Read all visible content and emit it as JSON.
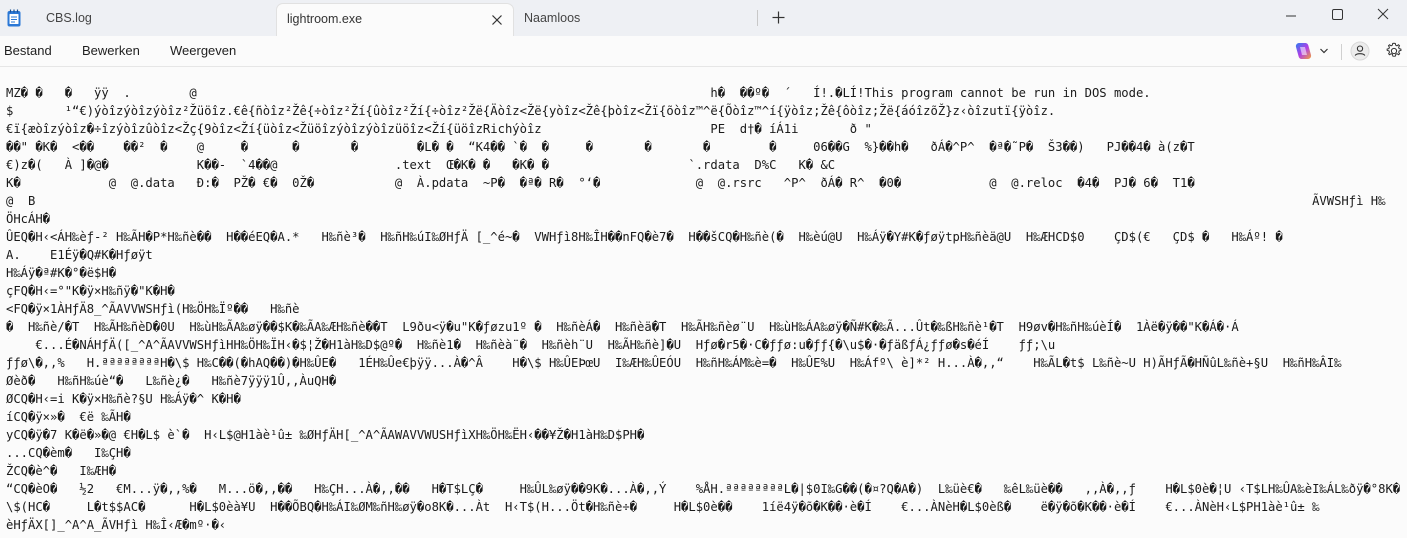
{
  "tabs": [
    {
      "label": "CBS.log"
    },
    {
      "label": "lightroom.exe"
    },
    {
      "label": "Naamloos"
    }
  ],
  "menu": [
    "Bestand",
    "Bewerken",
    "Weergeven"
  ],
  "icons": {
    "app": "notepad-icon",
    "close": "close-icon",
    "new_tab": "plus-icon",
    "minimize": "minimize-icon",
    "maximize": "maximize-icon",
    "window_close": "close-icon",
    "copilot": "copilot-icon",
    "account": "profile-icon",
    "settings": "gear-icon"
  },
  "colors": {
    "tab_bar": "#eef0f4",
    "editor_bg": "#fbfbfb",
    "text": "#1a1a1a"
  },
  "content": [
    "MZ� �   �   ÿÿ  .        @                                                                      h�  ��º�  ´   Í!.�LÍ!This program cannot be run in DOS mode.",
    "$       ¹“€)ýòîzýòîzýòîz²Žüöîz.€ê{ñòîz²Žê{÷òîz²Ží{ûòîz²Ží{÷òîz²Žë{Äòîz<Žë{yòîz<Žê{þòîz<Žï{õòîz™^ë{Õòîz™^í{ÿòîz;Žê{ôòîz;Žë{áóîzõŽ}z‹òîzutï{ÿòîz.",
    "€ï{æòîzýòîz�÷îzýòîzûòîz<Žç{9òîz<Ží{üòîz<Žüöîzýòîzýòîzüöîz<Ží{üöîzRichýòîz                       PE  d†� íÁ1i       ð \"",
    "��\" �K�  <��    ��²  �    @     �      �       �        �L� �  “K4�� `�  �     �       �       �        �     06��G  %}��h�   ðÁ�^P^  �ª�˜P�  Š3��)   PJ��4� à(z�T",
    "€)z�(   À ]�@�            K��-  `4��@                .text  Œ�K� �   �K� �                   `.rdata  D%C   K� &C",
    "K�            @  @.data   Ð:�  PŽ� €�  0Ž�           @  À.pdata  ~P�  �ª� R�  °‘�             @  @.rsrc   ^P^  ðÁ� R^  �0�            @  @.reloc  �4�  PJ� 6�  T1�",
    "@  B                                                                                                                                                                              ÃVWSHƒì H‰",
    "ÖHcÁH�",
    "ÛEQ�H‹<ÁH‰èƒ-² H‰ÃH�P*H‰ñè��  H��éEQ�A.*   H‰ñè³�  H‰ñH‰úI‰ØHƒÄ [_^é~�  VWHƒì8H‰ÎH��nFQ�è7�  H��šCQ�H‰ñè(�  H‰èú@U  H‰Áÿ�Y#K�ƒøÿtpH‰ñèä@U  H‰ÆHCD$0    ÇD$(€   ÇD$ �   H‰Áº! �",
    "A.    E1Éÿ�Q#K�Hƒøÿt",
    "H‰Áÿ�ª#K�°�ë$H�",
    "çFQ�H‹=°\"K�ÿ×H‰ñÿ�\"K�H�",
    "<FQ�ÿ×1ÀHƒÄ8_^ÃAVVWSHƒì(H‰ÖH‰Ïº��   H‰ñè",
    "�  H‰ñè/�T  H‰ÃH‰ñèD�0U  H‰ùH‰ÃA‰øÿ��$K�‰ÃA‰ÆH‰ñè��T  L9ðu<ÿ�u\"K�ƒøzu1º �  H‰ñèÁ�  H‰ñèä�T  H‰ÃH‰ñèø¨U  H‰ùH‰ÁA‰øÿ�Ñ#K�‰Ã...Ût�‰ßH‰ñè¹�T  H9øv�H‰ñH‰úèÍ�  1Àë�ÿ��\"K�Á�·Á",
    "    €...É�NÁHƒÄ([_^A^ÃAVVWSHƒìHH‰ÖH‰ÏH‹�$¦Ž�H1àH‰D$@º�  H‰ñè1�  H‰ñèà¨�  H‰ñèh¨U  H‰ÃH‰ñè]�U  Hƒø�r5�·C�ƒƒø:u�ƒƒ{�\\u$�·�ƒäßƒÁ¿ƒƒø�s�éÍ    ƒƒ;\\u",
    "ƒƒø\\�,,%   H.ªªªªªªªªH�\\$ H‰C��(�hAQ��)�H‰ÛE�   1ÉH‰Ûe€þÿÿ...À�^Â    H�\\$ H‰ÛEÞœU  I‰ÆH‰ÛEÓU  H‰ñH‰ÁM‰è=�  H‰ÛE%U  H‰Áfº\\ è]*² H...À�,,“    H‰ÃL�t$ L‰ñè~U H)ÃHƒÃ�HÑûL‰ñè+§U  H‰ñH‰ÂI‰",
    "Øèð�   H‰ñH‰úè“�   L‰ñè¿�   H‰ñè7ÿÿÿ1Û,,ÀuQH�",
    "ØCQ�H‹=i K�ÿ×H‰ñè?§U H‰Áÿ�^ K�H�",
    "íCQ�ÿ×»�  €ë ‰ÃH�",
    "yCQ�ÿ�7 K�ë�»�@ €H�L$ è`�  H‹L$@H1àè¹û± ‰ØHƒÄH[_^A^ÃAWAVVWUSHƒìXH‰ÖH‰ËH‹��¥Ž�H1àH‰D$PH�",
    "...CQ�èm�   I‰ÇH�",
    "ŽCQ�è^�   I‰ÆH�",
    "“CQ�èO�   ½2   €M...ÿ�,,%�   M...ö�,,��   H‰ÇH...À�,,��   H�T$LÇ�     H‰ÛL‰øÿ��9K�...À�,,Ý    %ÅH.ªªªªªªªªL�|$0I‰G��(�¤?Q�A�)  L‰üè€�   ‰êL‰üè��   ,,À�,,ƒ    H�L$0è�¦U ‹T$LH‰ÛA‰èI‰ÁL‰ðÿ�°8K�...Àt_H�",
    "\\$(HC�     L�t$$AC�      H�L$0èà¥U  H��ÕBQ�H‰ÁI‰ØM‰ñH‰øÿ�o8K�...Àt  H‹T$(H...Öt�H‰ñè÷�     H�L$0è��    1íë4ÿ�õ�K��·è�Í    €...ÀNèH�L$0èß�    ë�ÿ�õ�K��·è�Í    €...ÀNèH‹L$PH1àè¹û± ‰",
    "èHƒÄX[]_^A^A_ÃVHƒì H‰Î‹Æ�mº·�‹"
  ]
}
